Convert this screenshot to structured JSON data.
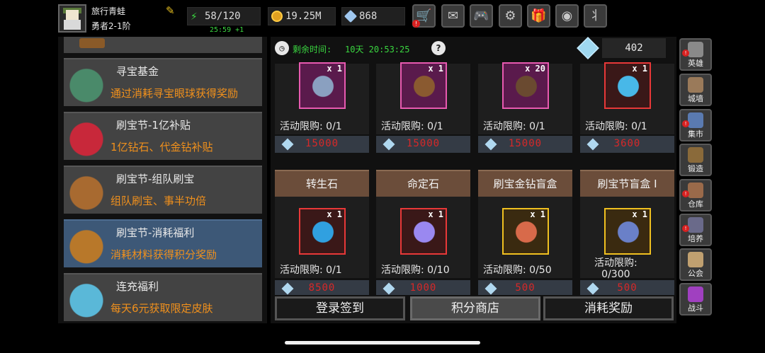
{
  "player": {
    "name": "旅行青蛙",
    "rank": "勇者2-1阶"
  },
  "resources": {
    "energy": "58/120",
    "energy_timer": "25:59 +1",
    "gold": "19.25M",
    "gems": "868"
  },
  "top_buttons": [
    {
      "name": "shop-cart-icon",
      "glyph": "🛒",
      "badge": "!"
    },
    {
      "name": "mail-icon",
      "glyph": "✉",
      "badge": ""
    },
    {
      "name": "gamepad-icon",
      "glyph": "🎮",
      "badge": ""
    },
    {
      "name": "gear-icon",
      "glyph": "⚙",
      "badge": ""
    },
    {
      "name": "gift-icon",
      "glyph": "🎁",
      "badge": ""
    },
    {
      "name": "color-wheel-icon",
      "glyph": "◉",
      "badge": ""
    },
    {
      "name": "wheat-icon",
      "glyph": "⺦",
      "badge": ""
    }
  ],
  "events": [
    {
      "title": "寻宝基金",
      "desc": "通过消耗寻宝眼球获得奖励",
      "icon_color": "#4a8a6a"
    },
    {
      "title": "刷宝节-1亿补贴",
      "desc": "1亿钻石、代金钻补贴",
      "icon_color": "#c8283a"
    },
    {
      "title": "刷宝节-组队刷宝",
      "desc": "组队刷宝、事半功倍",
      "icon_color": "#a86a30"
    },
    {
      "title": "刷宝节-消耗福利",
      "desc": "消耗材料获得积分奖励",
      "icon_color": "#b8782a"
    },
    {
      "title": "连充福利",
      "desc": "每天6元获取限定皮肤",
      "icon_color": "#5ab8d8"
    }
  ],
  "shop": {
    "remaining_label": "剩余时间:",
    "remaining_value": "10天 20:53:25",
    "points": "402",
    "row1": [
      {
        "qty": "x 1",
        "frame": "pink",
        "limit": "活动限购: 0/1",
        "price": "15000",
        "art_color": "#8aa0c0"
      },
      {
        "qty": "x 1",
        "frame": "pink",
        "limit": "活动限购: 0/1",
        "price": "15000",
        "art_color": "#8a5a30"
      },
      {
        "qty": "x 20",
        "frame": "pink",
        "limit": "活动限购: 0/1",
        "price": "15000",
        "art_color": "#6a4a30"
      },
      {
        "qty": "x 1",
        "frame": "red",
        "limit": "活动限购: 0/1",
        "price": "3600",
        "art_color": "#48b8e8"
      }
    ],
    "row2": [
      {
        "name": "转生石",
        "qty": "x 1",
        "frame": "red",
        "limit": "活动限购: 0/1",
        "price": "8500",
        "art_color": "#30a0e0"
      },
      {
        "name": "命定石",
        "qty": "x 1",
        "frame": "red",
        "limit": "活动限购: 0/10",
        "price": "1000",
        "art_color": "#9a88f0"
      },
      {
        "name": "刷宝金钻盲盒",
        "qty": "x 1",
        "frame": "gold",
        "limit": "活动限购: 0/50",
        "price": "500",
        "art_color": "#d86a4a"
      },
      {
        "name": "刷宝节盲盒 I",
        "qty": "x 1",
        "frame": "gold",
        "limit": "活动限购:\n0/300",
        "price": "500",
        "art_color": "#6a80c8"
      }
    ],
    "tabs": [
      "登录签到",
      "积分商店",
      "消耗奖励"
    ]
  },
  "right_nav": [
    {
      "label": "英雄",
      "badge": "!",
      "color": "#8a8a8a"
    },
    {
      "label": "城墙",
      "badge": "",
      "color": "#9a7a5a"
    },
    {
      "label": "集市",
      "badge": "!",
      "color": "#5a7ab0"
    },
    {
      "label": "锻造",
      "badge": "",
      "color": "#8a6a3a"
    },
    {
      "label": "仓库",
      "badge": "!",
      "color": "#9a6a4a"
    },
    {
      "label": "培养",
      "badge": "!",
      "color": "#6a6a8a"
    },
    {
      "label": "公会",
      "badge": "",
      "color": "#c0a070"
    },
    {
      "label": "战斗",
      "badge": "",
      "color": "#a040c0"
    }
  ]
}
